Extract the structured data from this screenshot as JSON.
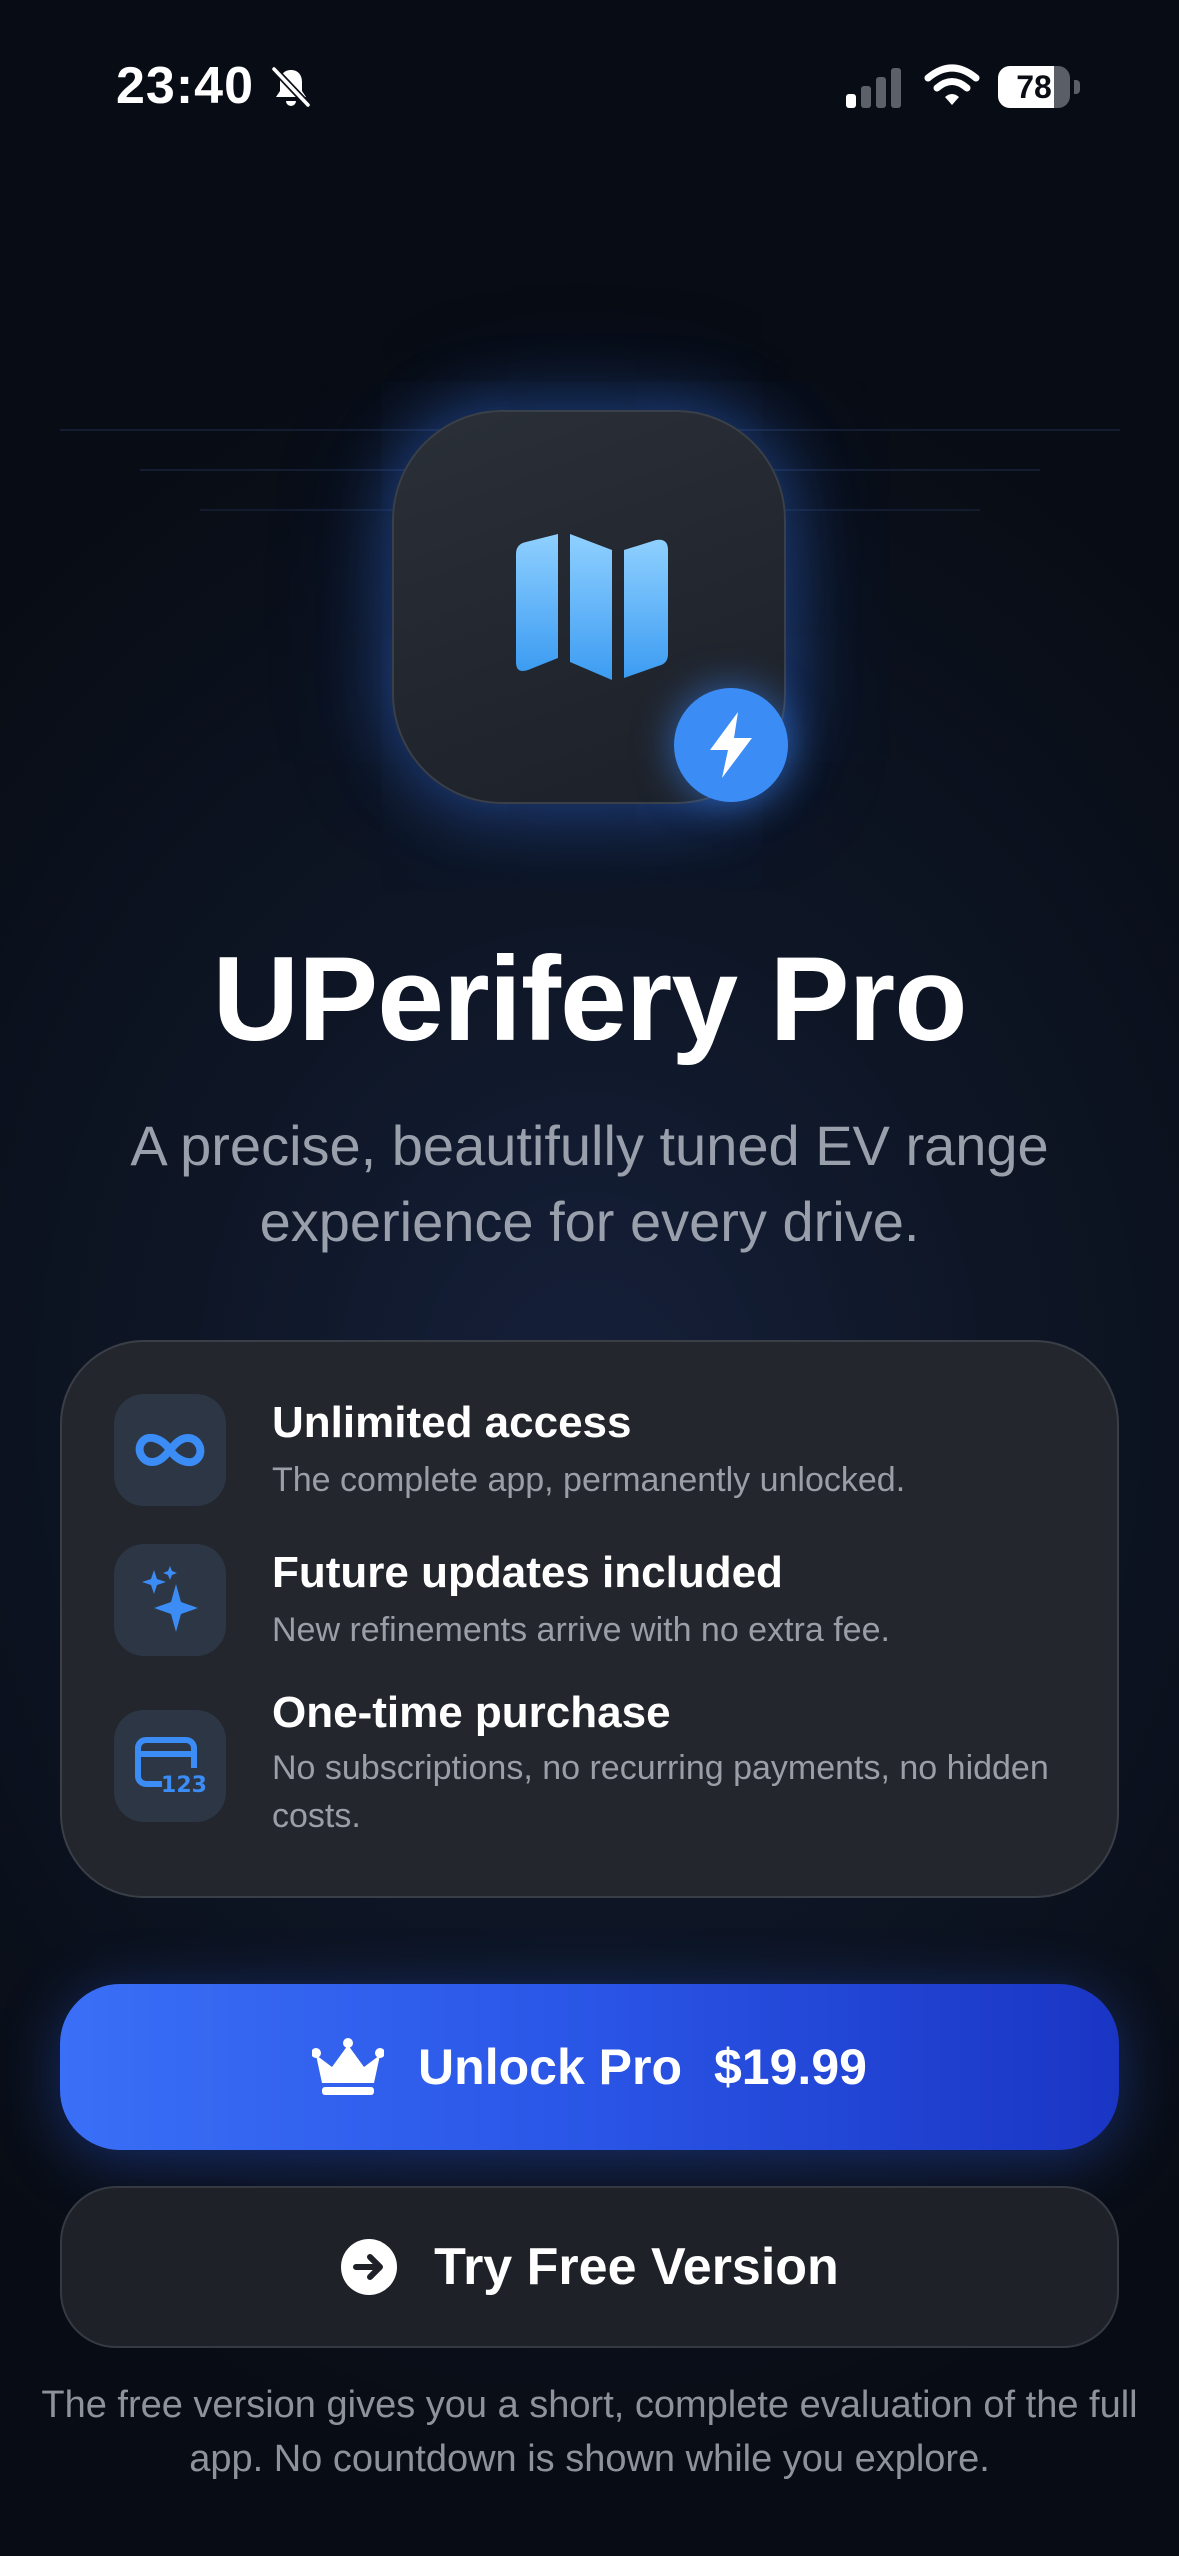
{
  "status_bar": {
    "time": "23:40",
    "battery_level": "78",
    "battery_fraction": 0.78,
    "icons": [
      "bell-slash-icon",
      "cellular-signal-icon",
      "wifi-icon",
      "battery-icon"
    ]
  },
  "hero": {
    "app_icon": "folded-map-icon",
    "badge_icon": "lightning-bolt-icon",
    "title": "UPerifery Pro",
    "subtitle": "A precise, beautifully tuned EV range experience for every drive."
  },
  "features": [
    {
      "icon": "infinity-icon",
      "title": "Unlimited access",
      "description": "The complete app, permanently unlocked."
    },
    {
      "icon": "sparkles-icon",
      "title": "Future updates included",
      "description": "New refinements arrive with no extra fee."
    },
    {
      "icon": "creditcard-123-icon",
      "title": "One-time purchase",
      "description": "No subscriptions, no recurring payments, no hidden costs."
    }
  ],
  "actions": {
    "unlock": {
      "icon": "crown-icon",
      "label": "Unlock Pro",
      "price": "$19.99"
    },
    "free": {
      "icon": "arrow-right-circle-icon",
      "label": "Try Free Version"
    }
  },
  "footnote": "The free version gives you a short, complete evaluation of the full app. No countdown is shown while you explore.",
  "colors": {
    "accent": "#3b8cf5",
    "unlock_start": "#3a6ff7",
    "unlock_end": "#1a35c4",
    "card_bg": "#23262c",
    "muted_text": "#9aa0ab"
  }
}
